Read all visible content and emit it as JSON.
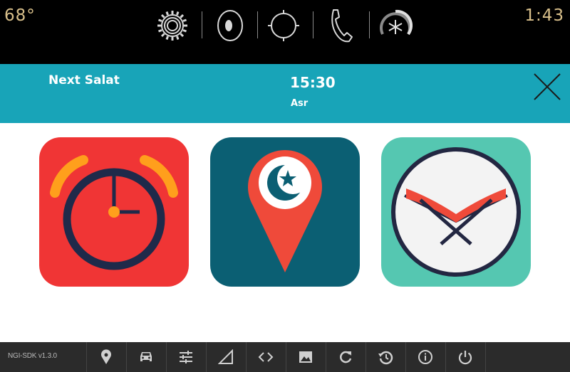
{
  "status_bar": {
    "temperature": "68°",
    "time": "1:43",
    "icons": [
      "settings-gear-icon",
      "speaker-icon",
      "navigation-icon",
      "phone-icon",
      "climate-fan-icon"
    ]
  },
  "salat": {
    "label": "Next Salat",
    "time": "15:30",
    "prayer": "Asr"
  },
  "tiles": [
    {
      "name": "alarm-clock-tile",
      "icon": "alarm-clock-icon",
      "color": "#f03535"
    },
    {
      "name": "mosque-locator-tile",
      "icon": "crescent-star-pin-icon",
      "color": "#0b5f73"
    },
    {
      "name": "quran-tile",
      "icon": "quran-book-icon",
      "color": "#55c7b1"
    }
  ],
  "toolbar": {
    "version": "NGI-SDK v1.3.0",
    "icons": [
      "location-pin-icon",
      "car-icon",
      "sliders-icon",
      "signal-icon",
      "code-icon",
      "image-icon",
      "refresh-icon",
      "history-icon",
      "info-icon",
      "power-icon"
    ]
  },
  "colors": {
    "accent": "#18a4b8",
    "status_text": "#d9c08b",
    "toolbar_bg": "#2b2b2b"
  }
}
